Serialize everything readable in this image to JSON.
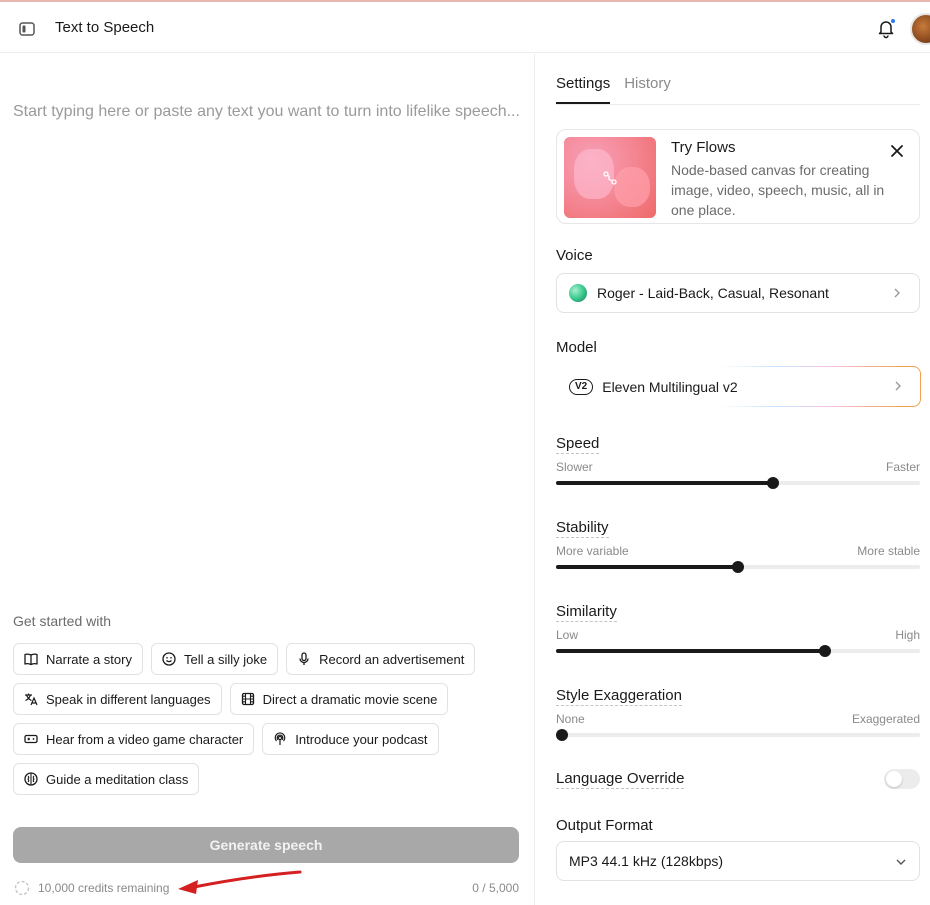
{
  "header": {
    "title": "Text to Speech",
    "has_notification": true
  },
  "editor": {
    "placeholder": "Start typing here or paste any text you want to turn into lifelike speech..."
  },
  "get_started": {
    "label": "Get started with",
    "rows": [
      [
        {
          "label": "Narrate a story",
          "icon": "book-icon"
        },
        {
          "label": "Tell a silly joke",
          "icon": "smiley-icon"
        },
        {
          "label": "Record an advertisement",
          "icon": "microphone-icon"
        }
      ],
      [
        {
          "label": "Speak in different languages",
          "icon": "translate-icon"
        },
        {
          "label": "Direct a dramatic movie scene",
          "icon": "film-icon"
        }
      ],
      [
        {
          "label": "Hear from a video game character",
          "icon": "gamepad-icon"
        },
        {
          "label": "Introduce your podcast",
          "icon": "podcast-icon"
        }
      ],
      [
        {
          "label": "Guide a meditation class",
          "icon": "brain-icon"
        }
      ]
    ]
  },
  "footer": {
    "generate_label": "Generate speech",
    "credits": "10,000 credits remaining",
    "char_count": "0 / 5,000"
  },
  "tabs": [
    {
      "label": "Settings",
      "active": true
    },
    {
      "label": "History",
      "active": false
    }
  ],
  "promo": {
    "title": "Try Flows",
    "description": "Node-based canvas for creating image, video, speech, music, all in one place."
  },
  "voice": {
    "label": "Voice",
    "value": "Roger - Laid-Back, Casual, Resonant"
  },
  "model": {
    "label": "Model",
    "badge": "V2",
    "value": "Eleven Multilingual v2"
  },
  "sliders": [
    {
      "key": "speed",
      "label": "Speed",
      "min_label": "Slower",
      "max_label": "Faster",
      "value": 0.596
    },
    {
      "key": "stability",
      "label": "Stability",
      "min_label": "More variable",
      "max_label": "More stable",
      "value": 0.5
    },
    {
      "key": "similarity",
      "label": "Similarity",
      "min_label": "Low",
      "max_label": "High",
      "value": 0.74
    },
    {
      "key": "style",
      "label": "Style Exaggeration",
      "min_label": "None",
      "max_label": "Exaggerated",
      "value": 0.0
    }
  ],
  "language_override": {
    "label": "Language Override",
    "enabled": false
  },
  "output_format": {
    "label": "Output Format",
    "value": "MP3 44.1 kHz (128kbps)"
  },
  "colors": {
    "accent": "#1a1a1a",
    "notification": "#2a7bf4",
    "annotation_arrow": "#d42020"
  }
}
